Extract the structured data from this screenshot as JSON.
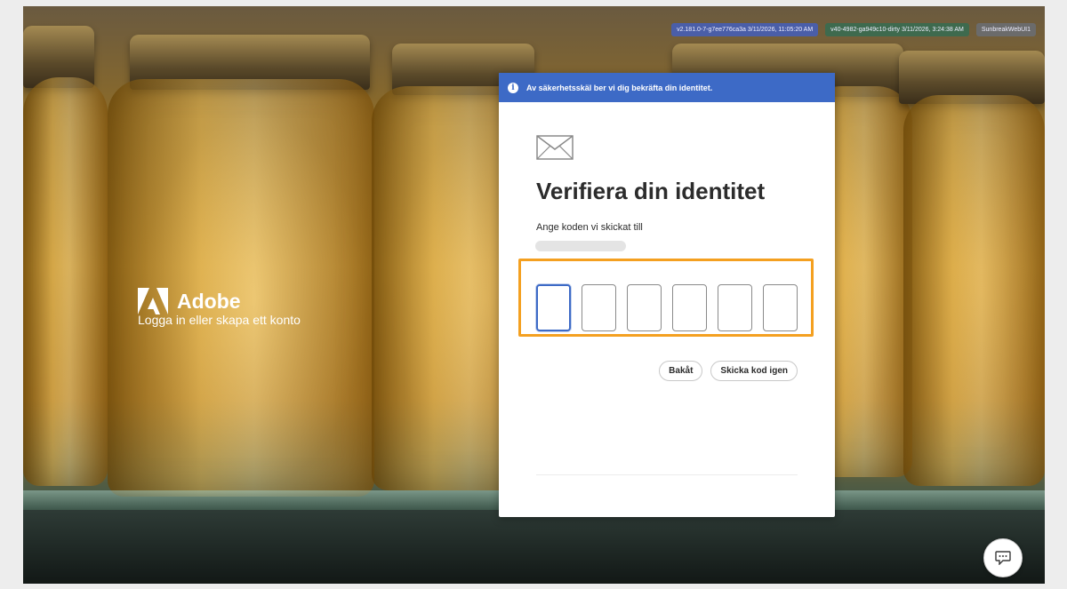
{
  "build": {
    "version_badge": "v2.181.0-7-g7ee776ca3a 3/11/2026, 11:05:20 AM",
    "service_badge": "v40-4982-ga949c10-dirty 3/11/2026, 3:24:38 AM",
    "app_badge": "SunbreakWebUI1"
  },
  "brand": {
    "name": "Adobe",
    "tagline": "Logga in eller skapa ett konto"
  },
  "dialog": {
    "banner_text": "Av säkerhetsskäl ber vi dig bekräfta din identitet.",
    "title": "Verifiera din identitet",
    "subtitle": "Ange koden vi skickat till",
    "code_digits": [
      "",
      "",
      "",
      "",
      "",
      ""
    ],
    "back_label": "Bakåt",
    "resend_label": "Skicka kod igen"
  },
  "icons": {
    "info": "info-icon",
    "mail": "mail-icon",
    "chat": "chat-icon"
  },
  "colors": {
    "accent": "#3d6ac6",
    "highlight": "#f4a020"
  }
}
